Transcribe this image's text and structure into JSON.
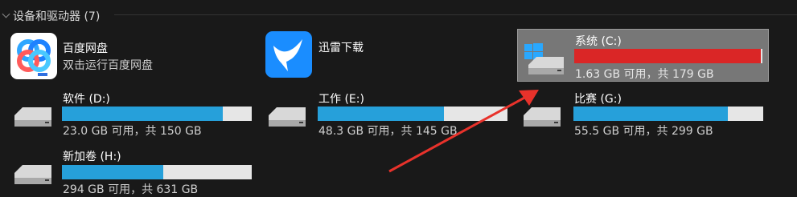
{
  "group": {
    "title": "设备和驱动器 (7)"
  },
  "apps": [
    {
      "name": "百度网盘",
      "subtitle": "双击运行百度网盘",
      "icon": "baidu-netdisk-icon"
    },
    {
      "name": "迅雷下载",
      "icon": "thunder-download-icon"
    }
  ],
  "drives": {
    "c": {
      "name": "系统 (C:)",
      "space": "1.63 GB 可用，共 179 GB",
      "used_fraction": 0.991,
      "bar_color": "#da2626"
    },
    "d": {
      "name": "软件 (D:)",
      "space": "23.0 GB 可用，共 150 GB",
      "used_fraction": 0.847
    },
    "e": {
      "name": "工作 (E:)",
      "space": "48.3 GB 可用，共 145 GB",
      "used_fraction": 0.667
    },
    "g": {
      "name": "比赛 (G:)",
      "space": "55.5 GB 可用，共 299 GB",
      "used_fraction": 0.814
    },
    "h": {
      "name": "新加卷 (H:)",
      "space": "294 GB 可用，共 631 GB",
      "used_fraction": 0.534
    }
  },
  "colors": {
    "bar_fill": "#26a0da",
    "bar_full": "#da2626",
    "bar_track": "#e6e6e6",
    "arrow": "#e8322b"
  }
}
